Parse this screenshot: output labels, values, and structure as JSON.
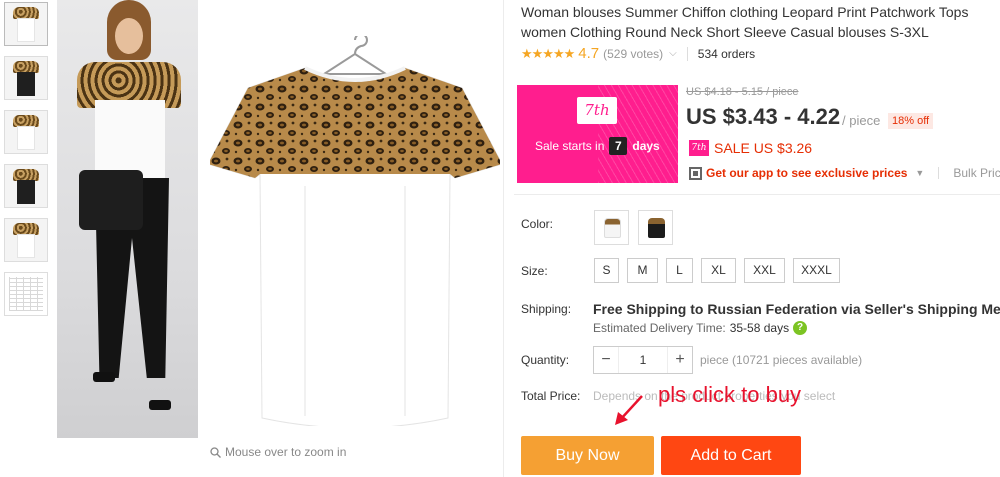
{
  "product": {
    "title_line1": "Woman blouses Summer Chiffon clothing Leopard Print Patchwork Tops",
    "title_line2": "women Clothing Round Neck Short Sleeve Casual blouses S-3XL"
  },
  "rating": {
    "stars": "★★★★★",
    "score": "4.7",
    "votes": "(529 votes)",
    "orders": "534 orders"
  },
  "sale_banner": {
    "date_badge": "7th",
    "starts_text": "Sale starts in",
    "days_number": "7",
    "days_label": "days",
    "color": "#ff1e8e"
  },
  "pricing": {
    "old_price": "US $4.18 - 5.15 / piece",
    "price": "US $3.43 - 4.22",
    "per_piece": "/ piece",
    "discount": "18% off",
    "sale_badge": "7th",
    "sale_price": "SALE US $3.26",
    "app_text": "Get our app to see exclusive prices",
    "bulk_text": "Bulk Price"
  },
  "options": {
    "color_label": "Color:",
    "colors": [
      "white-leopard",
      "black-leopard"
    ],
    "size_label": "Size:",
    "sizes": [
      "S",
      "M",
      "L",
      "XL",
      "XXL",
      "XXXL"
    ]
  },
  "shipping": {
    "label": "Shipping:",
    "main_text": "Free Shipping to Russian Federation via Seller's Shipping Me",
    "estimated_label": "Estimated Delivery Time:",
    "estimated_days": "35-58 days"
  },
  "quantity": {
    "label": "Quantity:",
    "minus": "−",
    "value": "1",
    "plus": "+",
    "note": "piece (10721 pieces available)"
  },
  "total": {
    "label": "Total Price:",
    "note": "Depends on the product properties you select",
    "annotation": "pls click to buy"
  },
  "buttons": {
    "buy_now": "Buy Now",
    "add_to_cart": "Add to Cart"
  },
  "gallery": {
    "zoom_hint": "Mouse over to zoom in"
  },
  "colors": {
    "accent_orange": "#f5a033",
    "cart_red": "#ff4712",
    "sale_pink": "#ff1e8e",
    "price_red": "#e62e04"
  }
}
